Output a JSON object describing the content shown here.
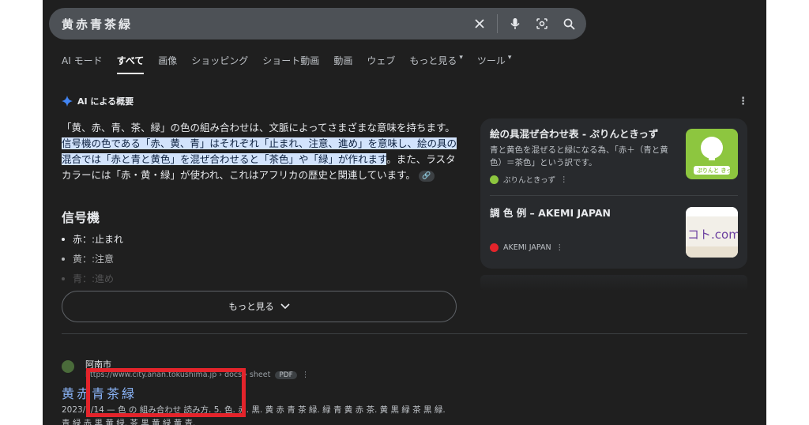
{
  "search": {
    "query": "黄赤青茶緑"
  },
  "tabs": [
    {
      "label": "AI モード"
    },
    {
      "label": "すべて"
    },
    {
      "label": "画像"
    },
    {
      "label": "ショッピング"
    },
    {
      "label": "ショート動画"
    },
    {
      "label": "動画"
    },
    {
      "label": "ウェブ"
    },
    {
      "label": "もっと見る"
    },
    {
      "label": "ツール"
    }
  ],
  "ai_overview": {
    "heading": "AI による概要",
    "p_plain1": "「黄、赤、青、茶、緑」の色の組み合わせは、文脈によってさまざまな意味を持ちます。",
    "p_hl": "信号機の色である「赤、黄、青」はそれぞれ「止まれ、注意、進め」を意味し、絵の具の混合では「赤と青と黄色」を混ぜ合わせると「茶色」や「緑」が作れます",
    "p_plain2": "。また、ラスタカラーには「赤・黄・緑」が使われ、これはアフリカの歴史と関連しています。",
    "section_title": "信号機",
    "items": [
      {
        "label": "赤：:止まれ"
      },
      {
        "label": "黄：:注意"
      },
      {
        "label": "青：:進め"
      }
    ],
    "more_label": "もっと見る"
  },
  "sources": [
    {
      "title": "絵の具混ぜ合わせ表 - ぷりんときっず",
      "desc": "青と黄色を混ぜると緑になる為、「赤＋（青と黄色）＝茶色」という訳です。",
      "site": "ぷりんときっず",
      "thumb_text": "ぷりんと きっず"
    },
    {
      "title": "調 色 例 – AKEMI JAPAN",
      "desc": "",
      "site": "AKEMI JAPAN",
      "thumb_text": "コト.com"
    }
  ],
  "result": {
    "site_name": "阿南市",
    "url": "https://www.city.anan.tokushima.jp › docs › sheet",
    "badge": "PDF",
    "title": "黄赤青茶緑",
    "snippet1": "2023/3/14 — 色 の 組み合わせ 読み方. 5. 色. 赤. 黒. 黄 赤 青 茶 緑. 緑 青 黄 赤 茶. 黄 黒 緑 茶 黒 緑.",
    "snippet2": "青 緑 赤 黒 黄 緑. 茶 黒 黄 緑 黄 青."
  },
  "colors": {
    "highlight": "#e3242b",
    "link": "#8ab4f8",
    "accent": "#4285f4"
  }
}
